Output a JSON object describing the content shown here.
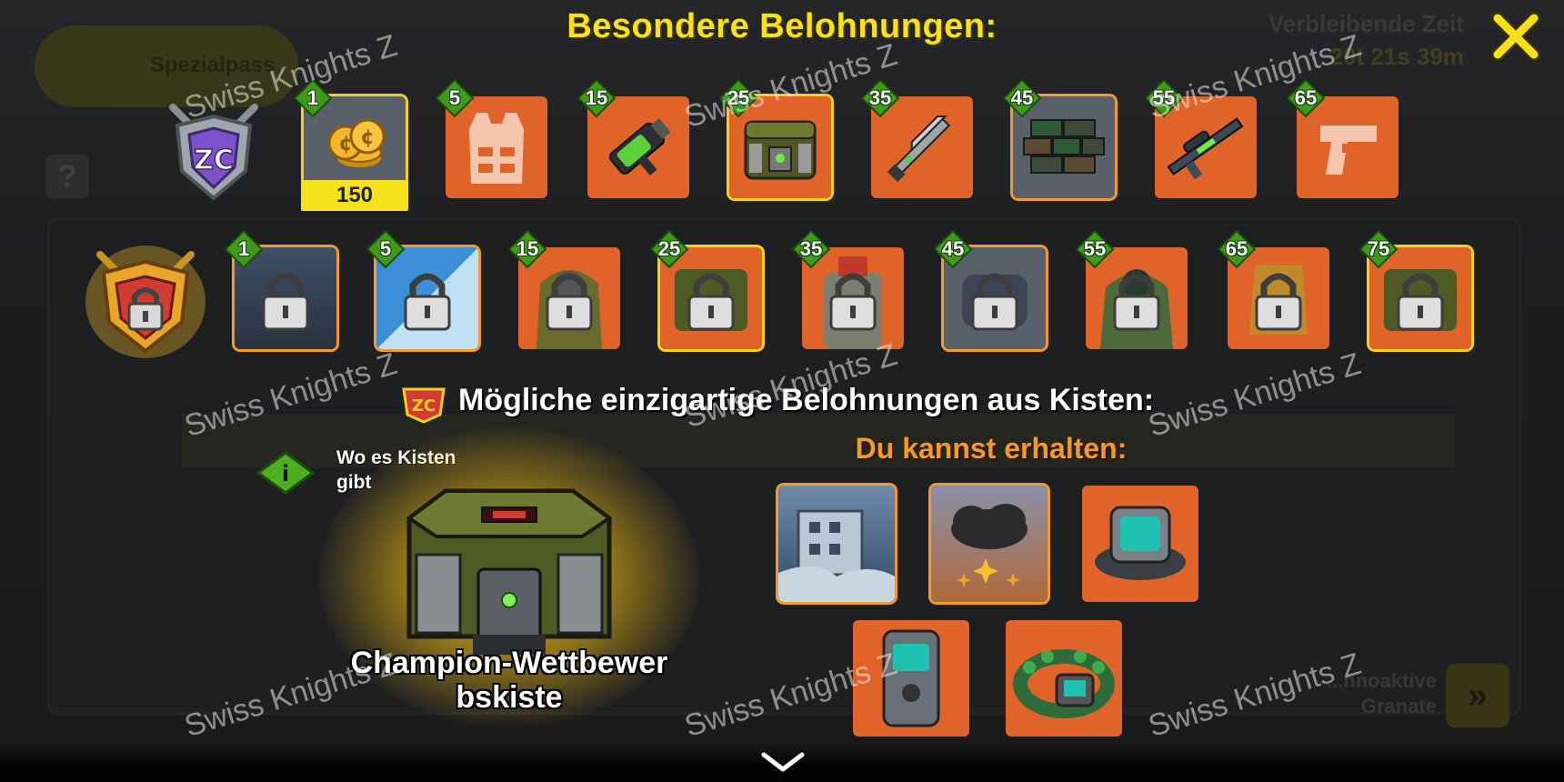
{
  "background": {
    "pass_label": "Spezialpass",
    "timer_label": "Verbleibende Zeit",
    "timer_value": "20t 21s 39m",
    "help": "?",
    "bottom_button_label": "...nnoaktive Granate"
  },
  "dialog": {
    "title": "Besondere Belohnungen:",
    "close_icon": "close-icon",
    "free_track": {
      "emblem": "zc-silver-emblem",
      "rewards": [
        {
          "level": "1",
          "item": "coins",
          "amount": "150",
          "bg": "gray"
        },
        {
          "level": "5",
          "item": "vest-icon",
          "bg": "orange"
        },
        {
          "level": "15",
          "item": "grenade-launcher",
          "bg": "orange"
        },
        {
          "level": "25",
          "item": "military-chest",
          "bg": "orange"
        },
        {
          "level": "35",
          "item": "sword-rifle",
          "bg": "orange"
        },
        {
          "level": "45",
          "item": "camo-bricks",
          "bg": "gray"
        },
        {
          "level": "55",
          "item": "sniper-rifle",
          "bg": "orange"
        },
        {
          "level": "65",
          "item": "pistol-icon",
          "bg": "orange"
        }
      ]
    },
    "premium_track": {
      "emblem": "locked-gold-emblem",
      "rewards": [
        {
          "level": "1",
          "item": "locked-vehicle",
          "bg": "gray"
        },
        {
          "level": "5",
          "item": "locked-blue-skin",
          "bg": "blue"
        },
        {
          "level": "15",
          "item": "locked-gasmask-soldier",
          "bg": "orange"
        },
        {
          "level": "25",
          "item": "locked-chest",
          "bg": "orange"
        },
        {
          "level": "35",
          "item": "locked-robot",
          "bg": "orange"
        },
        {
          "level": "45",
          "item": "locked-gray-item",
          "bg": "gray"
        },
        {
          "level": "55",
          "item": "locked-green-soldier",
          "bg": "orange"
        },
        {
          "level": "65",
          "item": "locked-armor",
          "bg": "orange"
        },
        {
          "level": "75",
          "item": "locked-chest-2",
          "bg": "orange"
        }
      ]
    },
    "unique_heading": "Mögliche einzigartige Belohnungen aus Kisten:",
    "info_text_line1": "Wo es Kisten",
    "info_text_line2": "gibt",
    "chest_name_line1": "Champion-Wettbewer",
    "chest_name_line2": "bskiste",
    "can_get_heading": "Du kannst erhalten:",
    "possible_rewards": [
      {
        "item": "ruined-city-background"
      },
      {
        "item": "storm-cloud-effect"
      },
      {
        "item": "wrist-device-1"
      },
      {
        "item": "wrist-device-2"
      },
      {
        "item": "wrist-device-3"
      }
    ],
    "bottom_chevron": "chevron-down-icon"
  },
  "watermark": "Swiss Knights Z",
  "colors": {
    "title_yellow": "#f7e21a",
    "orange_tile": "#e0642a",
    "badge_green": "#3f9a1a",
    "heading_orange": "#f49a22"
  }
}
